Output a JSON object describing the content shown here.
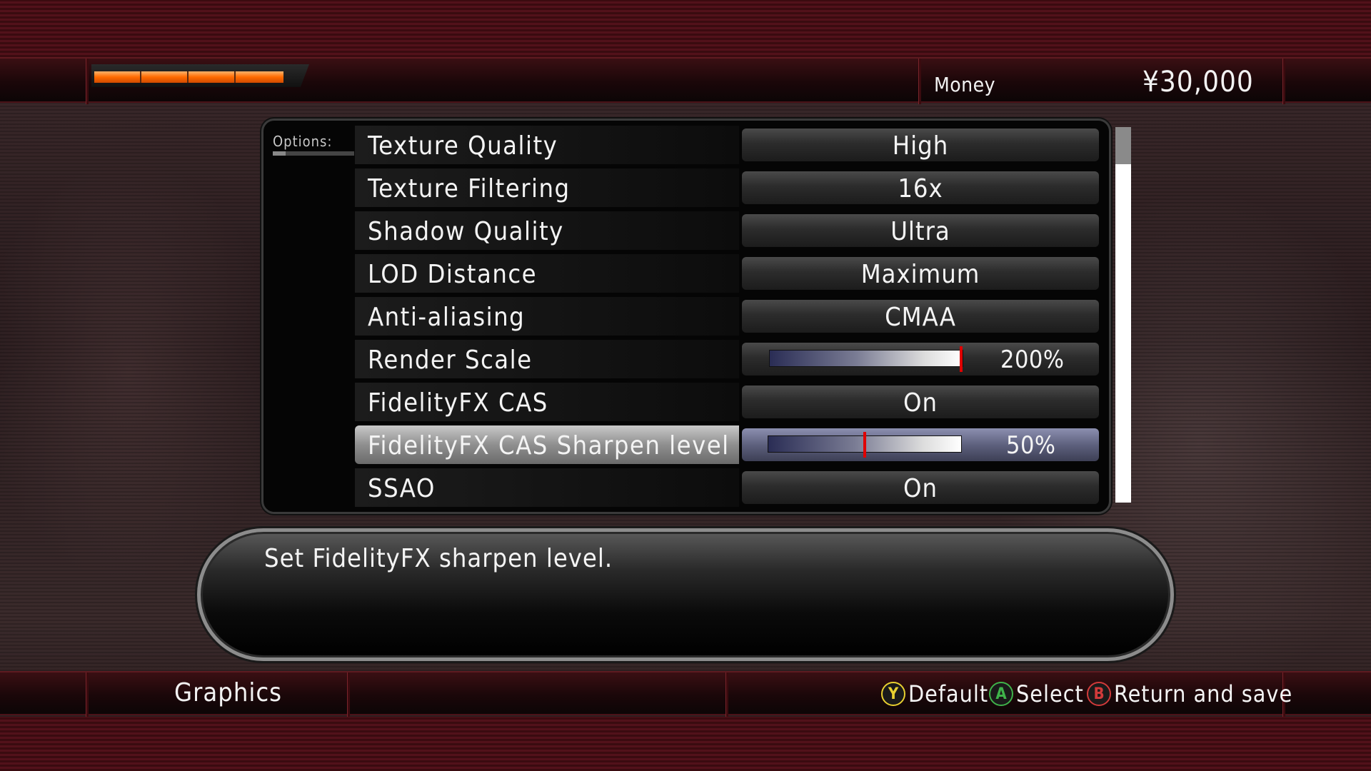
{
  "hud": {
    "health_fraction": 0.87,
    "money_label": "Money",
    "money_value": "¥30,000"
  },
  "options": {
    "label": "Options:",
    "scroll_position_fraction": 0.0,
    "items": [
      {
        "name": "Texture Quality",
        "value": "High",
        "type": "choice"
      },
      {
        "name": "Texture Filtering",
        "value": "16x",
        "type": "choice"
      },
      {
        "name": "Shadow Quality",
        "value": "Ultra",
        "type": "choice"
      },
      {
        "name": "LOD Distance",
        "value": "Maximum",
        "type": "choice"
      },
      {
        "name": "Anti-aliasing",
        "value": "CMAA",
        "type": "choice"
      },
      {
        "name": "Render Scale",
        "value": "200%",
        "type": "slider",
        "level_fraction": 1.0
      },
      {
        "name": "FidelityFX CAS",
        "value": "On",
        "type": "choice"
      },
      {
        "name": "FidelityFX CAS Sharpen level",
        "value": "50%",
        "type": "slider",
        "level_fraction": 0.5,
        "selected": true
      },
      {
        "name": "SSAO",
        "value": "On",
        "type": "choice"
      }
    ]
  },
  "description": "Set FidelityFX sharpen level.",
  "footer": {
    "section": "Graphics",
    "hints": [
      {
        "button": "Y",
        "label": "Default",
        "color": "#e8d030"
      },
      {
        "button": "A",
        "label": "Select",
        "color": "#3fb24a"
      },
      {
        "button": "B",
        "label": "Return and save",
        "color": "#d03a3a"
      }
    ]
  },
  "colors": {
    "slider_marker": "#e00000",
    "selected_row": "#5e617e",
    "health": "#ff6a00"
  }
}
